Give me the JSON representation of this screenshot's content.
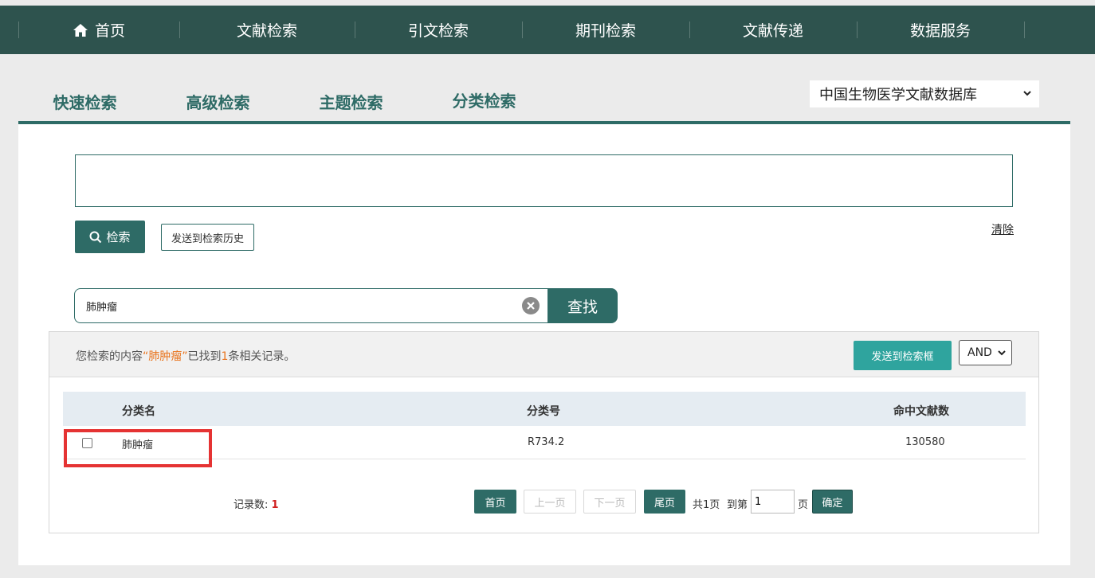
{
  "topnav": {
    "items": [
      {
        "label": "首页"
      },
      {
        "label": "文献检索"
      },
      {
        "label": "引文检索"
      },
      {
        "label": "期刊检索"
      },
      {
        "label": "文献传递"
      },
      {
        "label": "数据服务"
      }
    ]
  },
  "tabs": [
    {
      "label": "快速检索"
    },
    {
      "label": "高级检索"
    },
    {
      "label": "主题检索"
    },
    {
      "label": "分类检索",
      "active": true
    }
  ],
  "database_select": {
    "value": "中国生物医学文献数据库"
  },
  "query": {
    "value": "",
    "search_button": "检索",
    "history_button": "发送到检索历史",
    "clear_link": "清除"
  },
  "find": {
    "value": "肺肿瘤",
    "button": "查找"
  },
  "result": {
    "msg_prefix": "您检索的内容",
    "keyword": "“肺肿瘤”",
    "msg_mid": "已找到",
    "count": "1",
    "msg_suffix": "条相关记录。",
    "send_button": "发送到检索框",
    "operator": "AND"
  },
  "table": {
    "headers": {
      "name": "分类名",
      "code": "分类号",
      "hits": "命中文献数"
    },
    "rows": [
      {
        "name": "肺肿瘤",
        "code": "R734.2",
        "hits": "130580",
        "checked": false
      }
    ]
  },
  "pager": {
    "record_label": "记录数:",
    "record_count": "1",
    "first": "首页",
    "prev": "上一页",
    "next": "下一页",
    "last": "尾页",
    "total_pages": "共1页",
    "goto_label": "到第",
    "page_value": "1",
    "page_unit": "页",
    "confirm": "确定"
  }
}
